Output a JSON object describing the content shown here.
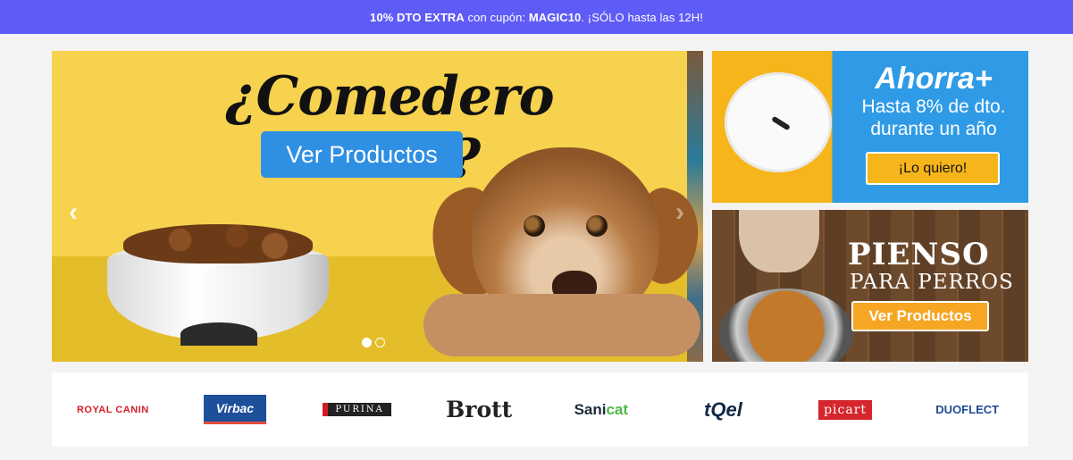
{
  "promo_bar": {
    "strong_1": "10% DTO EXTRA",
    "text_1": " con cupón: ",
    "strong_2": "MAGIC10",
    "text_2": ". ¡SÓLO hasta las 12H!"
  },
  "hero": {
    "title": "¿Comedero vacío?",
    "button_label": "Ver Productos",
    "arrow_left": "‹",
    "arrow_right": "›",
    "slide_count": 2,
    "active_slide": 1
  },
  "side_banner_top": {
    "title": "Ahorra+",
    "subtitle_line1": "Hasta 8% de dto.",
    "subtitle_line2": "durante un año",
    "button_label": "¡Lo quiero!"
  },
  "side_banner_bottom": {
    "title_line1": "PIENSO",
    "title_line2": "PARA PERROS",
    "button_label": "Ver Productos"
  },
  "brands": [
    {
      "name": "ROYAL CANIN"
    },
    {
      "name": "Virbac"
    },
    {
      "name": "PURINA"
    },
    {
      "name": "Brott"
    },
    {
      "name_1": "Sani",
      "name_2": "cat"
    },
    {
      "name": "tQel"
    },
    {
      "name": "picart"
    },
    {
      "name": "DUOFLECT"
    }
  ],
  "colors": {
    "promo_bar": "#5e5bf6",
    "hero_background": "#f6d24e",
    "hero_button": "#2f8fe3",
    "cta_orange": "#f6a623",
    "cta_yellow": "#f6b51a",
    "banner_blue": "#2f9be6"
  }
}
